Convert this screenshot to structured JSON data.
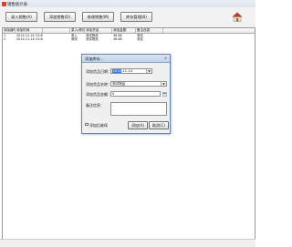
{
  "window": {
    "title": "销售统计表"
  },
  "toolbar": {
    "buttons": [
      "录入销售(A)",
      "添加销售(D)",
      "修改销售(M)",
      "库存管理(B)"
    ]
  },
  "table": {
    "headers": [
      "添加编号",
      "添加时间",
      "",
      "录入/修改",
      "添加货品",
      "添加金额",
      "备注信息"
    ],
    "rows": [
      [
        "1",
        "2014-11-14 15:40",
        "",
        "录入",
        "测试物品",
        "36.66",
        "测试"
      ],
      [
        "2",
        "2014-11-14 15:40",
        "",
        "修改",
        "测试物品",
        "36.66",
        "测试"
      ]
    ]
  },
  "dialog": {
    "title": "添加库存...",
    "close_glyph": "×",
    "date_label": "添加货品日期：",
    "date_value_selected": "2014",
    "date_value_rest": "-11-14",
    "item_label": "添加货品名称：",
    "item_value": "测试物品",
    "amount_label": "添加货品金额：",
    "amount_value": "0",
    "notes_label": "备注信息：",
    "continue_label": "添加后继续",
    "add_button": "添加(A)",
    "cancel_button": "取消(C)"
  }
}
